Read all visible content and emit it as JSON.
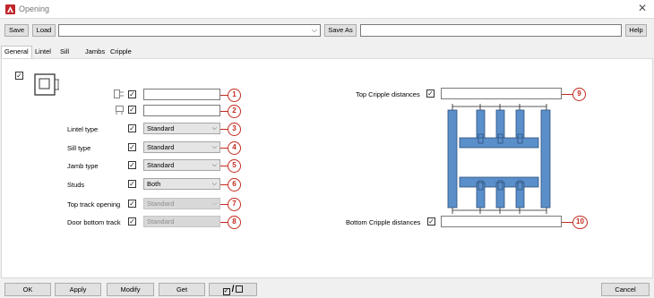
{
  "window": {
    "title": "Opening",
    "close_glyph": "✕"
  },
  "toolbar": {
    "save_label": "Save",
    "load_label": "Load",
    "preset_value": "",
    "save_as_label": "Save As",
    "save_as_value": "",
    "help_label": "Help"
  },
  "tabs": [
    "General",
    "Lintel",
    "Sill",
    "Jambs",
    "Cripple"
  ],
  "rows": [
    {
      "label": "",
      "value": "",
      "badge": "1"
    },
    {
      "label": "",
      "value": "",
      "badge": "2"
    },
    {
      "label": "Lintel type",
      "value": "Standard",
      "badge": "3"
    },
    {
      "label": "Sill type",
      "value": "Standard",
      "badge": "4"
    },
    {
      "label": "Jamb type",
      "value": "Standard",
      "badge": "5"
    },
    {
      "label": "Studs",
      "value": "Both",
      "badge": "6"
    },
    {
      "label": "Top track opening",
      "value": "Standard",
      "badge": "7"
    },
    {
      "label": "Door bottom track",
      "value": "Standard",
      "badge": "8"
    }
  ],
  "cripple": {
    "top_label": "Top Cripple distances",
    "top_value": "",
    "top_badge": "9",
    "bottom_label": "Bottom Cripple distances",
    "bottom_value": "",
    "bottom_badge": "10"
  },
  "footer": {
    "ok_label": "OK",
    "apply_label": "Apply",
    "modify_label": "Modify",
    "get_label": "Get",
    "toggle_separator": "/",
    "cancel_label": "Cancel"
  },
  "colors": {
    "badge": "#c22a1f",
    "frame_fill": "#5b8fca",
    "frame_stroke": "#2d4f7a"
  }
}
